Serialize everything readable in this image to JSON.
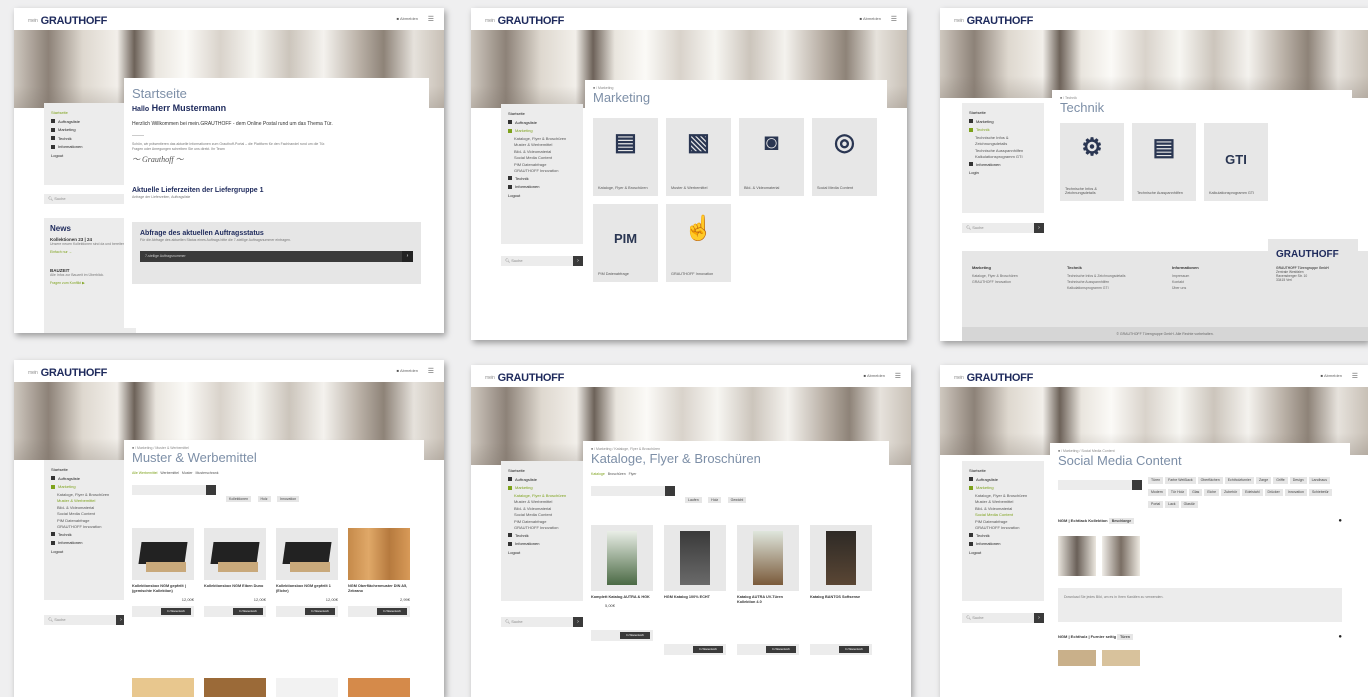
{
  "brand": {
    "logo": "GRAUTHOFF",
    "logo_prefix": "mein",
    "account": "Abmelden"
  },
  "panels": {
    "start": {
      "sidebar": [
        "Startseite",
        "Auftragsliste",
        "Marketing",
        "Technik",
        "Informationen",
        "Logout"
      ],
      "title": "Startseite",
      "greeting_prefix": "Hallo",
      "greeting_name": "Herr Mustermann",
      "welcome": "Herzlich Willkommen bei mein.GRAUTHOFF - dem Online Postal rund um das Thema Tür.",
      "body1": "Schön, wir präsentieren das aktuelle Informationen zum Grauthoff-Portal – die Plattform für den Fachhandel rund um die Tür.",
      "body2": "Fragen oder Anregungen schreiben Sie uns direkt. Ihr Team",
      "delivery_title": "Aktuelle Lieferzeiten der Liefergruppe 1",
      "delivery_sub": "Anfrage der Lieferzeiten, Auftragsliste",
      "status_title": "Abfrage des aktuellen Auftragsstatus",
      "status_sub": "Für die Abfrage des aktuellen Status eines Auftrags bitte die 7-stellige Auftragsnummer eintragen.",
      "status_placeholder": "7-stellige Auftragsnummer",
      "news_title": "News",
      "news_items": [
        {
          "head": "Kollektionen 23 | 24",
          "text": "Unsere neuen Kollektionen sind da und bereiten.",
          "link": "Einfach nur →"
        },
        {
          "head": "BAUZEIT",
          "text": "Alle Infos zur Bauzeit im Überblick.",
          "link": "Fragen zum Konflikt ▶"
        }
      ],
      "search_placeholder": "Suche"
    },
    "marketing": {
      "crumb": "■ / Marketing",
      "title": "Marketing",
      "sidebar": [
        "Startseite",
        "Auftragsliste",
        "Marketing",
        "Kataloge, Flyer & Broschüren",
        "Muster & Werbemittel",
        "Bild- & Videomaterial",
        "Social Media Content",
        "PIM Datenabfrage",
        "GRAUTHOFF Innovation",
        "Technik",
        "Informationen",
        "Logout"
      ],
      "tiles": [
        {
          "icon": "document-person-icon",
          "glyph": "🗎",
          "label": "Kataloge, Flyer & Broschüren"
        },
        {
          "icon": "cards-icon",
          "glyph": "🂠",
          "label": "Muster & Werbemittel"
        },
        {
          "icon": "camera-icon",
          "glyph": "📷",
          "label": "Bild- & Videomaterial"
        },
        {
          "icon": "social-media-icon",
          "glyph": "◎",
          "label": "Social Media Content"
        },
        {
          "icon": "pim-icon",
          "glyph": "PIM",
          "label": "PIM Datenabfrage"
        },
        {
          "icon": "touch-hand-icon",
          "glyph": "☝",
          "label": "GRAUTHOFF Innovation"
        }
      ],
      "search_placeholder": "Suche"
    },
    "technik": {
      "crumb": "■ / Technik",
      "title": "Technik",
      "sidebar": [
        "Startseite",
        "Marketing",
        "Technik",
        "Technische Infos & Zeichnungsdetails",
        "Technische Ausspannhilfen",
        "Kalkulationsprogramm GTI",
        "Informationen",
        "Login"
      ],
      "tiles": [
        {
          "icon": "technical-info-icon",
          "glyph": "⚙",
          "label": "Technische Infos & Zeichnungsdetails"
        },
        {
          "icon": "technical-document-icon",
          "glyph": "🗎",
          "label": "Technische Ausspannhilfen"
        },
        {
          "icon": "gti-icon",
          "glyph": "GTI",
          "label": "Kalkulationsprogramm GTI"
        }
      ],
      "footer_cols": [
        {
          "head": "Marketing",
          "items": [
            "Kataloge, Flyer & Broschüren",
            "GRAUTHOFF Innovation"
          ]
        },
        {
          "head": "Technik",
          "items": [
            "Technische Infos & Zeichnungsdetails",
            "Technische Ausspannhilfen",
            "Kalkulationsprogramm GTI"
          ]
        },
        {
          "head": "Informationen",
          "items": [
            "Impressum",
            "Kontakt",
            "Über uns"
          ]
        }
      ],
      "footer_logo": "GRAUTHOFF",
      "footer_address": [
        "GRAUTHOFF Türengruppe GmbH",
        "Zentrale Westfalen",
        "Ravensberger Str. 10",
        "33415 Verl"
      ],
      "footer_copyright": "© GRAUTHOFF Türengruppe GmbH. Alle Rechte vorbehalten.",
      "search_placeholder": "Suche"
    },
    "muster": {
      "crumb": "■ / Marketing / Muster & Werbemittel",
      "title": "Muster & Werbemittel",
      "filters": [
        "Alle Werbemittel",
        "Werbemittel",
        "Muster",
        "Musterschrank"
      ],
      "chips": [
        "Kollektionen",
        "Holz",
        "Innovation"
      ],
      "products": [
        {
          "name": "Kollektionsbox NGM gepfeilt | (gemischte Kollektion)",
          "price": "12,00€"
        },
        {
          "name": "Kollektionsbox NGM Eiben Duno",
          "price": "12,00€"
        },
        {
          "name": "Kollektionsbox NGM gepfeilt 1 (Eiche)",
          "price": "12,00€"
        },
        {
          "name": "NGM Oberflächenmuster DIN A5, Zebrano",
          "price": "2,99€"
        }
      ],
      "cart_label": "In Warenkorb",
      "sidebar": [
        "Startseite",
        "Auftragsliste",
        "Marketing",
        "Kataloge, Flyer & Broschüren",
        "Muster & Werbemittel",
        "Bild- & Videomaterial",
        "Social Media Content",
        "PIM Datenabfrage",
        "GRAUTHOFF Innovation",
        "Technik",
        "Informationen",
        "Logout"
      ],
      "search_placeholder": "Suche"
    },
    "kataloge": {
      "crumb": "■ / Marketing / Kataloge, Flyer & Broschüren",
      "title": "Kataloge, Flyer & Broschüren",
      "filters": [
        "Kataloge",
        "Broschüren",
        "Flyer"
      ],
      "chips": [
        "Laufen",
        "Holz",
        "Gewicht"
      ],
      "products": [
        {
          "name": "Komplett Katalog AUTRA & HGK",
          "price": "5,00€"
        },
        {
          "name": "HGM Katalog 100% ECHT",
          "price": ""
        },
        {
          "name": "Katalog AUTRA UV-Türen Kollektion 4.0",
          "price": ""
        },
        {
          "name": "Katalog BANTOS Softsense",
          "price": ""
        }
      ],
      "cart_label": "In Warenkorb",
      "sidebar": [
        "Startseite",
        "Auftragsliste",
        "Marketing",
        "Kataloge, Flyer & Broschüren",
        "Muster & Werbemittel",
        "Bild- & Videomaterial",
        "Social Media Content",
        "PIM Datenabfrage",
        "GRAUTHOFF Innovation",
        "Technik",
        "Informationen",
        "Logout"
      ],
      "search_placeholder": "Suche"
    },
    "social": {
      "crumb": "■ / Marketing / Social Media Content",
      "title": "Social Media Content",
      "chips": [
        "Türen",
        "Farbe Weißlack",
        "Oberflächen",
        "Echtholzfurnier",
        "Zarge",
        "Griffe",
        "Design",
        "Landhaus",
        "Modern",
        "Tür Holz",
        "Glas",
        "Eiche",
        "Zubehör",
        "Edelstahl",
        "Drücker",
        "Innovation",
        "Schiebetür",
        "Portal",
        "Lack",
        "Glastür"
      ],
      "sections": [
        {
          "title": "NGM | Echtlack Kollektion",
          "tag": "Beschlaege"
        },
        {
          "title": "NGM | Echtholz | Furnier seitig",
          "tag": "Türen"
        }
      ],
      "note": "Download Sie jedes Bild, um es in Ihren Kanälen zu verwenden.",
      "sidebar": [
        "Startseite",
        "Auftragsliste",
        "Marketing",
        "Kataloge, Flyer & Broschüren",
        "Muster & Werbemittel",
        "Bild- & Videomaterial",
        "Social Media Content",
        "PIM Datenabfrage",
        "GRAUTHOFF Innovation",
        "Technik",
        "Informationen",
        "Logout"
      ],
      "search_placeholder": "Suche"
    }
  },
  "colors": {
    "accent": "#7da21b",
    "brand": "#1e2a5c",
    "title": "#7d8fa7"
  }
}
